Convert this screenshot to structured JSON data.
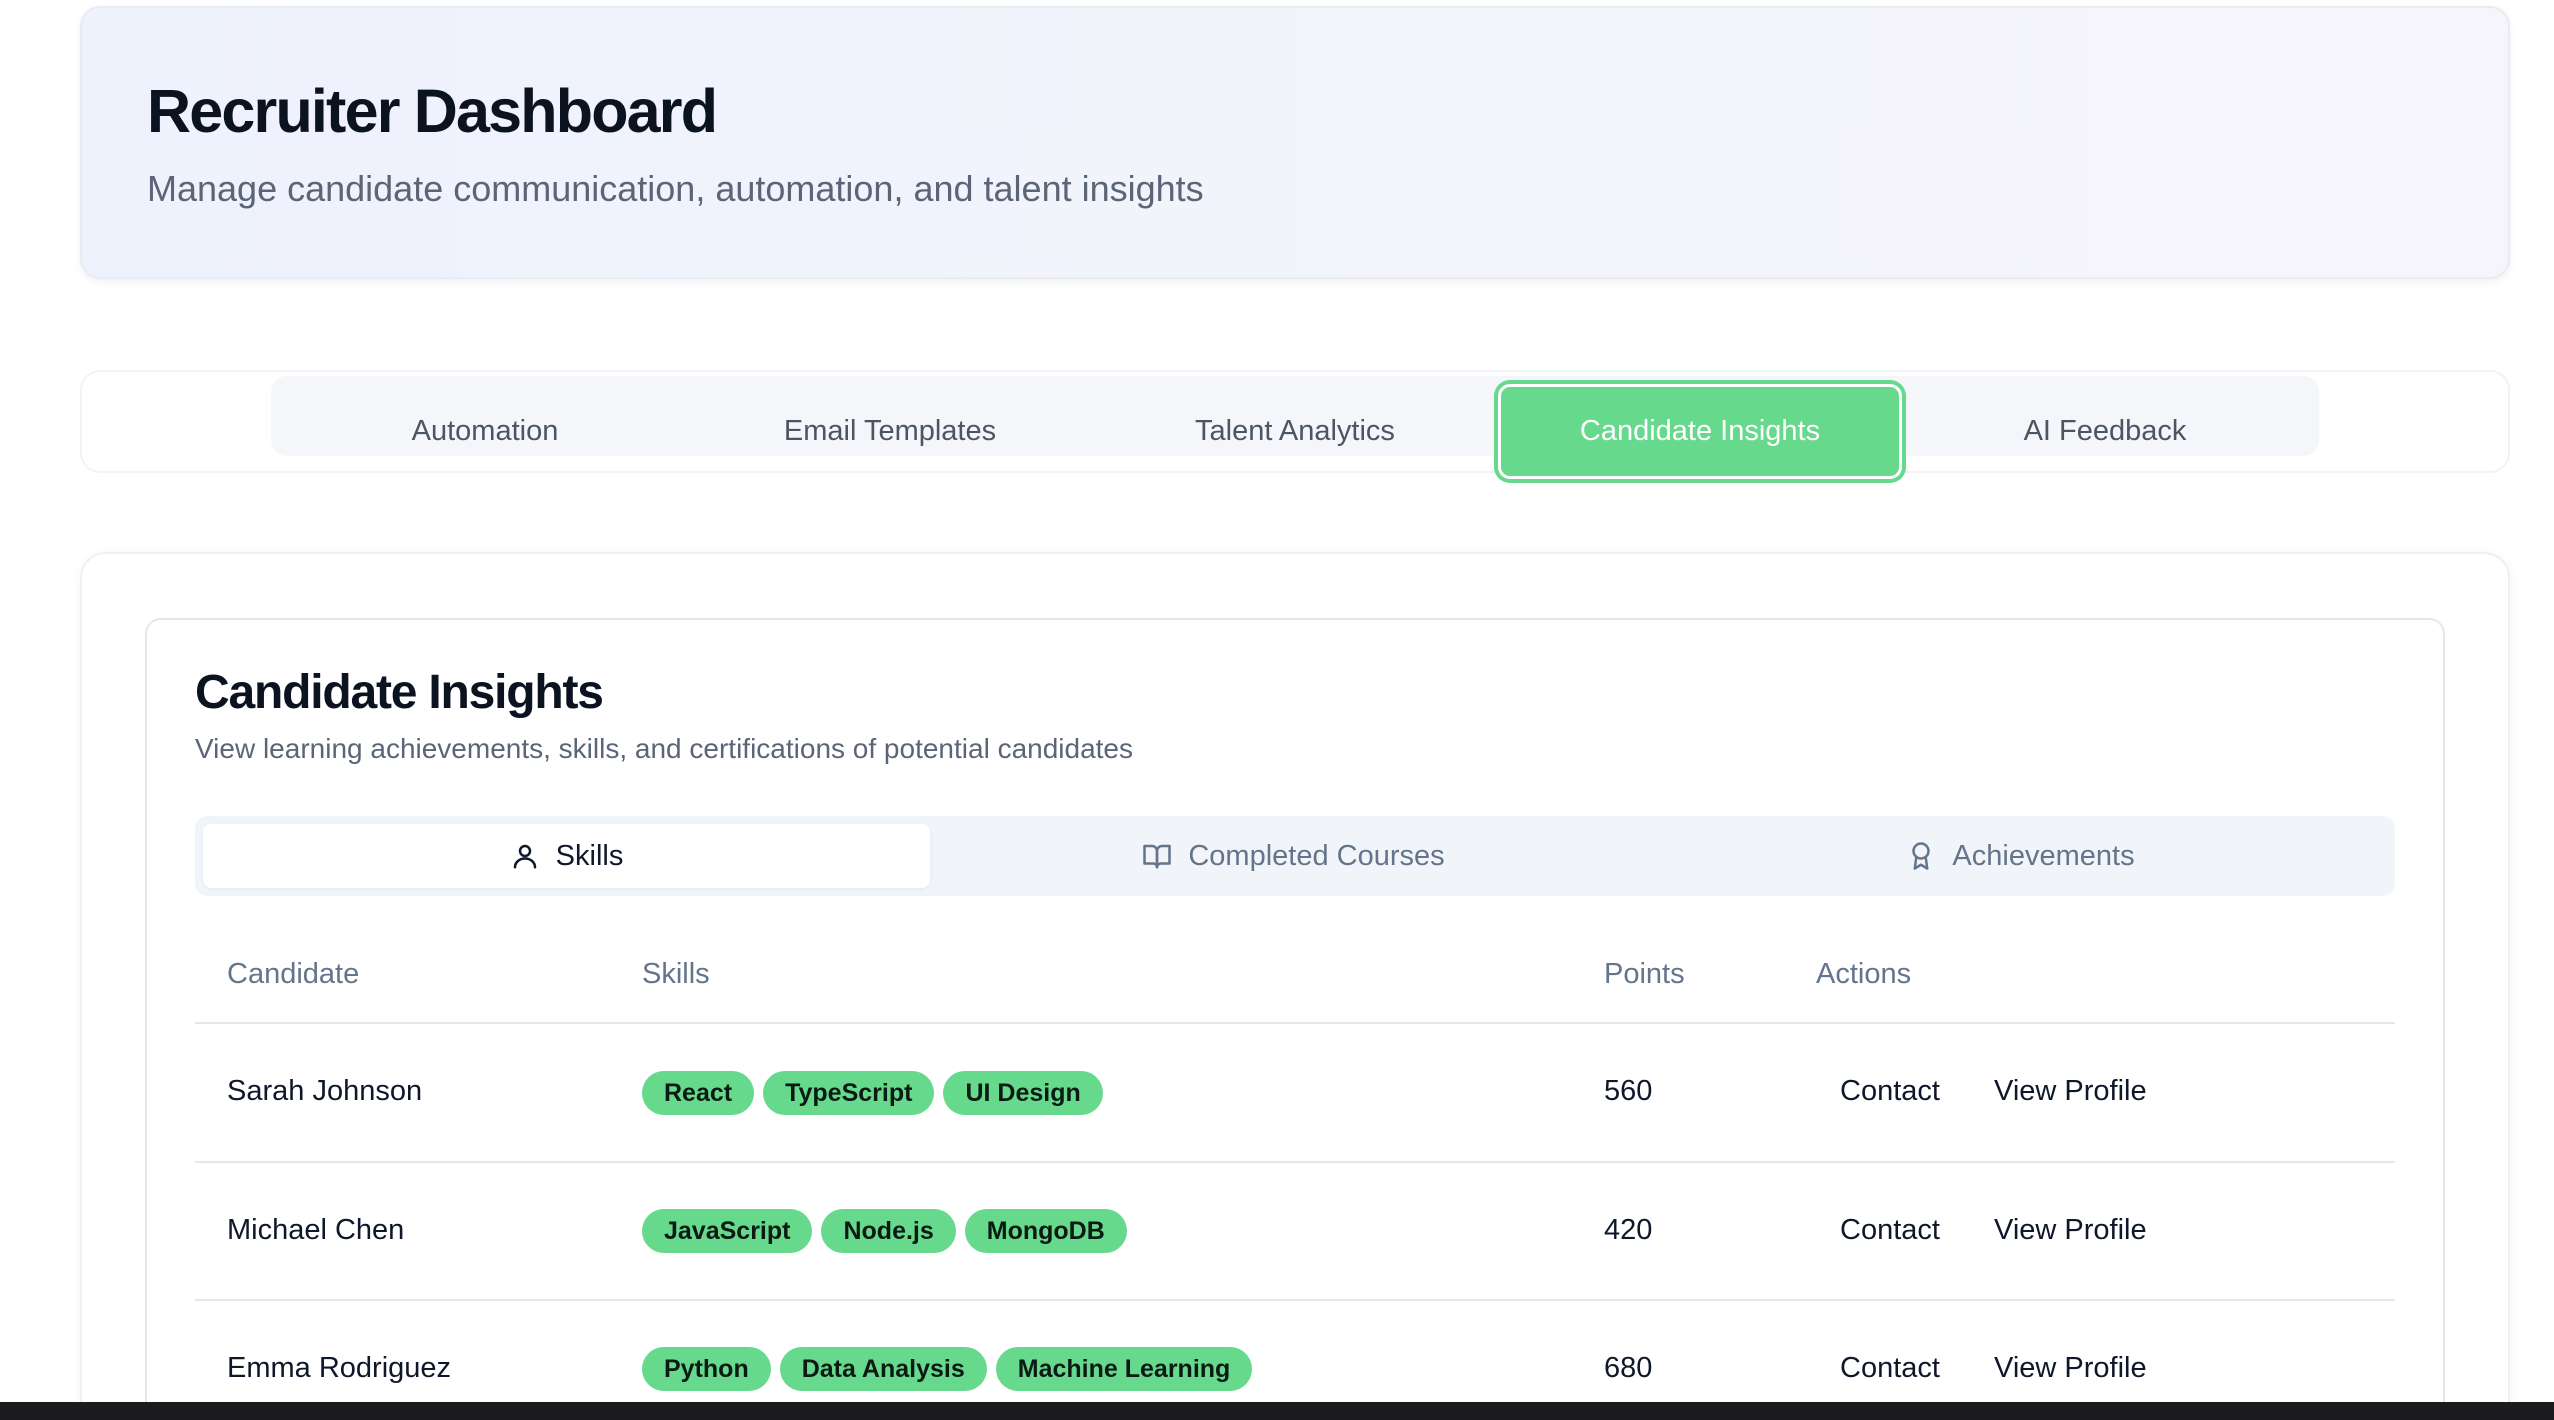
{
  "header": {
    "title": "Recruiter Dashboard",
    "subtitle": "Manage candidate communication, automation, and talent insights"
  },
  "main_tabs": [
    {
      "label": "Automation",
      "active": false
    },
    {
      "label": "Email Templates",
      "active": false
    },
    {
      "label": "Talent Analytics",
      "active": false
    },
    {
      "label": "Candidate Insights",
      "active": true
    },
    {
      "label": "AI Feedback",
      "active": false
    }
  ],
  "section": {
    "title": "Candidate Insights",
    "subtitle": "View learning achievements, skills, and certifications of potential candidates"
  },
  "sub_tabs": [
    {
      "label": "Skills",
      "icon": "user-icon",
      "active": true
    },
    {
      "label": "Completed Courses",
      "icon": "book-open-icon",
      "active": false
    },
    {
      "label": "Achievements",
      "icon": "award-icon",
      "active": false
    }
  ],
  "table": {
    "headers": [
      "Candidate",
      "Skills",
      "Points",
      "Actions"
    ],
    "rows": [
      {
        "name": "Sarah Johnson",
        "skills": [
          "React",
          "TypeScript",
          "UI Design"
        ],
        "points": "560",
        "actions": [
          "Contact",
          "View Profile"
        ]
      },
      {
        "name": "Michael Chen",
        "skills": [
          "JavaScript",
          "Node.js",
          "MongoDB"
        ],
        "points": "420",
        "actions": [
          "Contact",
          "View Profile"
        ]
      },
      {
        "name": "Emma Rodriguez",
        "skills": [
          "Python",
          "Data Analysis",
          "Machine Learning"
        ],
        "points": "680",
        "actions": [
          "Contact",
          "View Profile"
        ]
      }
    ]
  },
  "colors": {
    "accent": "#66d98d",
    "muted_text": "#64748b"
  }
}
